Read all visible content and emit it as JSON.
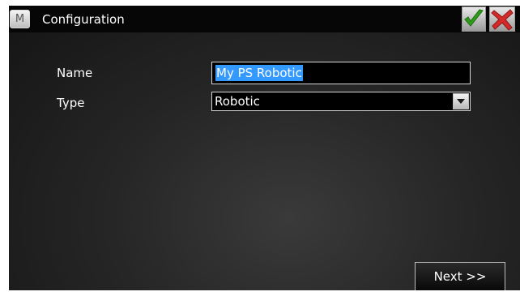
{
  "window": {
    "title": "Configuration",
    "app_icon_glyph": "M"
  },
  "titlebar_buttons": {
    "ok": {
      "icon": "checkmark-icon",
      "color": "#2e9e1a"
    },
    "cancel": {
      "icon": "x-icon",
      "color": "#d42a2a"
    }
  },
  "form": {
    "name_label": "Name",
    "name_value": "My PS Robotic",
    "type_label": "Type",
    "type_value": "Robotic"
  },
  "footer": {
    "next_label": "Next >>"
  },
  "colors": {
    "selection_highlight": "#3399ff",
    "field_border": "#d6d6d6"
  }
}
